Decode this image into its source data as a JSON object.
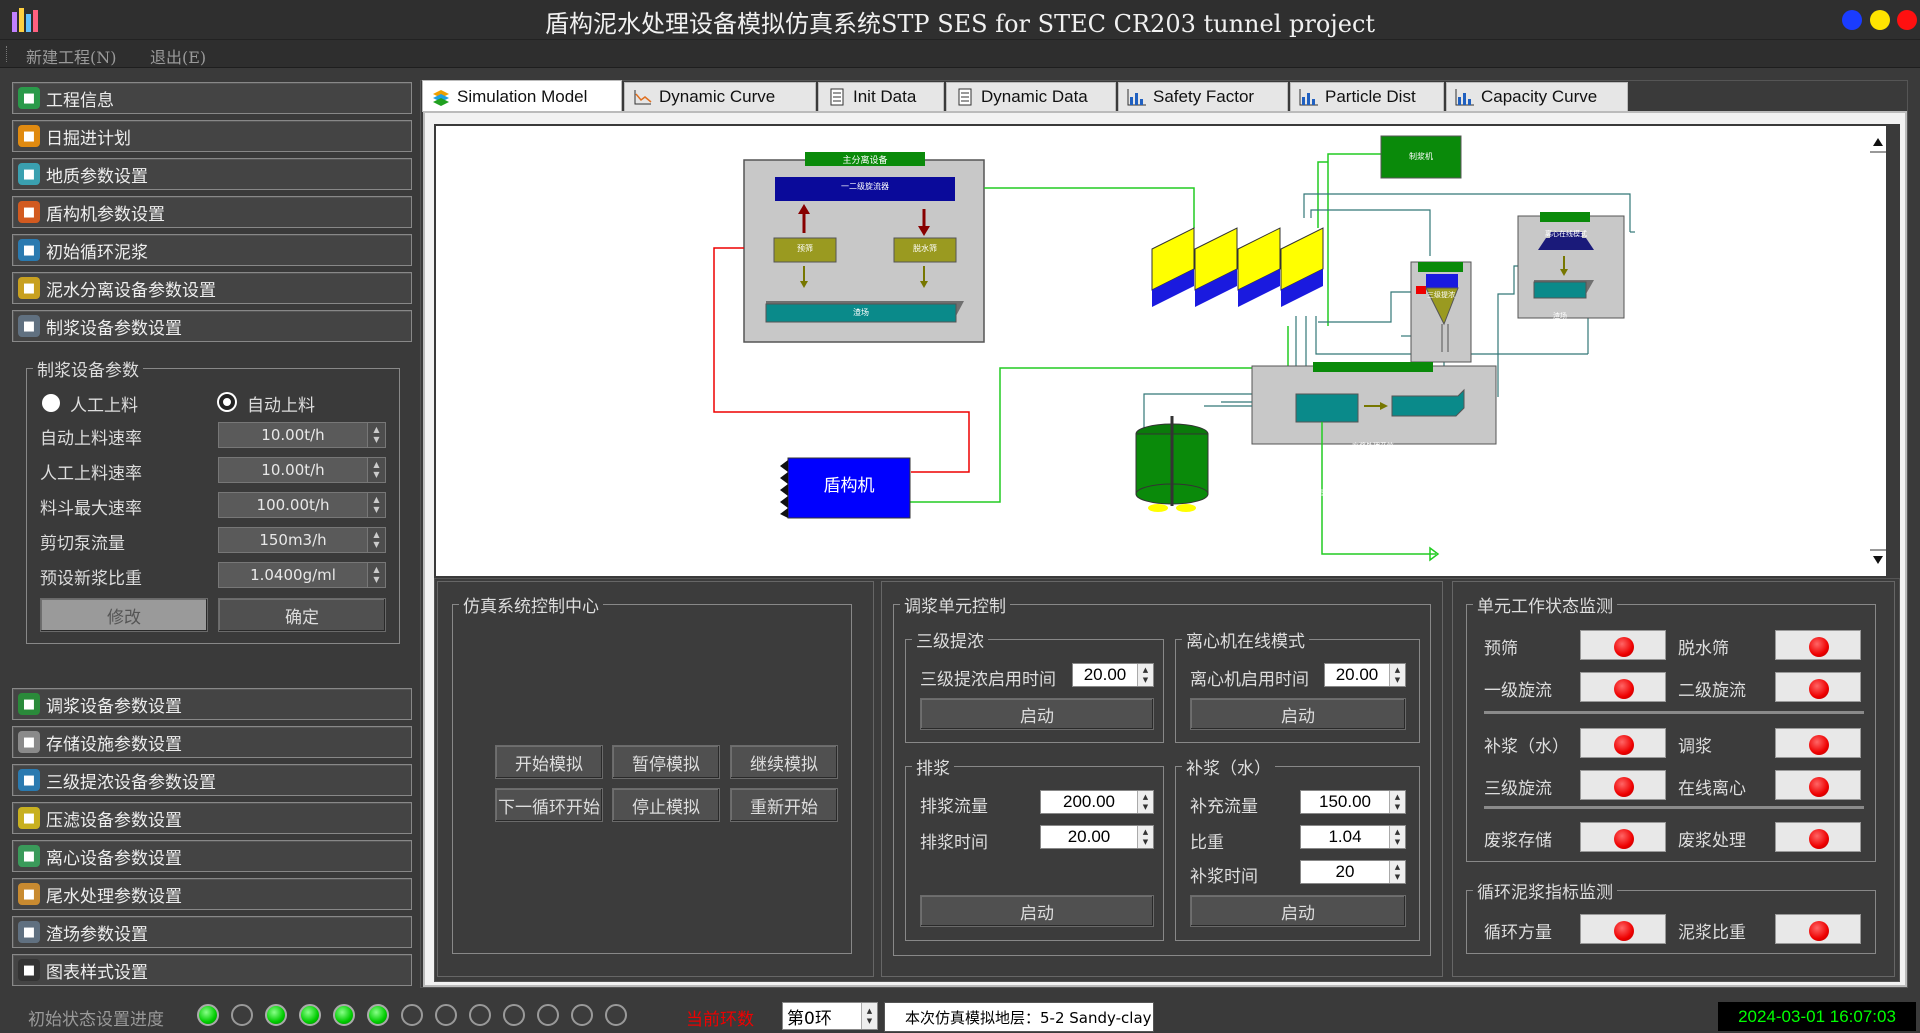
{
  "window": {
    "title": "盾构泥水处理设备模拟仿真系统STP SES for STEC CR203 tunnel project"
  },
  "menu": {
    "new_project": "新建工程(N)",
    "exit": "退出(E)"
  },
  "nav_top": [
    {
      "label": "工程信息",
      "icon": "project-info-icon",
      "color": "#2a9a4a"
    },
    {
      "label": "日掘进计划",
      "icon": "shield-badge-icon",
      "color": "#e08a10"
    },
    {
      "label": "地质参数设置",
      "icon": "layers-icon",
      "color": "#3aa0b0"
    },
    {
      "label": "盾构机参数设置",
      "icon": "gear-icon",
      "color": "#d25a20"
    },
    {
      "label": "初始循环泥浆",
      "icon": "table-icon",
      "color": "#2a7ab0"
    },
    {
      "label": "泥水分离设备参数设置",
      "icon": "stack-icon",
      "color": "#c8a020"
    },
    {
      "label": "制浆设备参数设置",
      "icon": "calculator-icon",
      "color": "#607080"
    }
  ],
  "slurry_panel": {
    "legend": "制浆设备参数",
    "radio_manual": "人工上料",
    "radio_auto": "自动上料",
    "fields": [
      {
        "label": "自动上料速率",
        "value": "10.00t/h"
      },
      {
        "label": "人工上料速率",
        "value": "10.00t/h"
      },
      {
        "label": "料斗最大速率",
        "value": "100.00t/h"
      },
      {
        "label": "剪切泵流量",
        "value": "150m3/h"
      },
      {
        "label": "预设新浆比重",
        "value": "1.0400g/ml"
      }
    ],
    "modify": "修改",
    "confirm": "确定"
  },
  "nav_bottom": [
    {
      "label": "调浆设备参数设置",
      "icon": "grid-icon",
      "color": "#2a8a3a"
    },
    {
      "label": "存储设施参数设置",
      "icon": "storage-icon",
      "color": "#8a8a8a"
    },
    {
      "label": "三级提浓设备参数设置",
      "icon": "funnel-icon",
      "color": "#2a7ab0"
    },
    {
      "label": "压滤设备参数设置",
      "icon": "calculator-icon",
      "color": "#c8b020"
    },
    {
      "label": "离心设备参数设置",
      "icon": "document-icon",
      "color": "#3a9a5a"
    },
    {
      "label": "尾水处理参数设置",
      "icon": "folder-icon",
      "color": "#c88a30"
    },
    {
      "label": "渣场参数设置",
      "icon": "ledger-icon",
      "color": "#607080"
    },
    {
      "label": "图表样式设置",
      "icon": "cube-icon",
      "color": "#333333"
    }
  ],
  "tabs": [
    {
      "label": "Simulation Model",
      "icon": "stack-icon"
    },
    {
      "label": "Dynamic Curve",
      "icon": "line-chart-icon"
    },
    {
      "label": "Init Data",
      "icon": "document-icon"
    },
    {
      "label": "Dynamic Data",
      "icon": "document-icon"
    },
    {
      "label": "Safety Factor",
      "icon": "bar-chart-icon"
    },
    {
      "label": "Particle Dist",
      "icon": "bar-chart-icon"
    },
    {
      "label": "Capacity Curve",
      "icon": "bar-chart-icon"
    }
  ],
  "diagram": {
    "main_sep": "主分离设备",
    "level12": "一二级旋流器",
    "presieve": "预筛",
    "dewater": "脱水筛",
    "tank": "渣场",
    "pulper": "制浆机",
    "tbm": "盾构机",
    "level3": "三级提浓",
    "centrifuge_mode": "离心在线模式",
    "centrifuge_tank": "渣场",
    "waste_system": "废浆处理系统",
    "filter_centrifuge": "压滤或离心",
    "waste_yard": "渣场"
  },
  "sim_ctrl": {
    "legend": "仿真系统控制中心",
    "start": "开始模拟",
    "pause": "暂停模拟",
    "resume": "继续模拟",
    "next": "下一循环开始",
    "stop": "停止模拟",
    "restart": "重新开始"
  },
  "mix_ctrl": {
    "legend": "调浆单元控制",
    "lvl3": {
      "legend": "三级提浓",
      "label": "三级提浓启用时间",
      "value": "20.00",
      "btn": "启动"
    },
    "centrifuge": {
      "legend": "离心机在线模式",
      "label": "离心机启用时间",
      "value": "20.00",
      "btn": "启动"
    },
    "discharge": {
      "legend": "排浆",
      "flow_label": "排浆流量",
      "flow": "200.00",
      "time_label": "排浆时间",
      "time": "20.00",
      "btn": "启动"
    },
    "refill": {
      "legend": "补浆（水）",
      "flow_label": "补充流量",
      "flow": "150.00",
      "density_label": "比重",
      "density": "1.04",
      "time_label": "补浆时间",
      "time": "20",
      "btn": "启动"
    }
  },
  "monitor": {
    "legend": "单元工作状态监测",
    "items": [
      {
        "label": "预筛"
      },
      {
        "label": "脱水筛"
      },
      {
        "label": "一级旋流"
      },
      {
        "label": "二级旋流"
      },
      {
        "label": "补浆（水）"
      },
      {
        "label": "调浆"
      },
      {
        "label": "三级旋流"
      },
      {
        "label": "在线离心"
      },
      {
        "label": "废浆存储"
      },
      {
        "label": "废浆处理"
      }
    ],
    "cycle_legend": "循环泥浆指标监测",
    "cycle_items": [
      {
        "label": "循环方量"
      },
      {
        "label": "泥浆比重"
      }
    ]
  },
  "status": {
    "progress_label": "初始状态设置进度",
    "leds": [
      1,
      0,
      1,
      1,
      1,
      1,
      0,
      0,
      0,
      0,
      0,
      0,
      0
    ],
    "current_ring_label": "当前环数",
    "ring_value": "第0环",
    "stratum": "本次仿真模拟地层：5-2 Sandy-clay",
    "datetime": "2024-03-01 16:07:03"
  },
  "colors": {
    "accent_green": "#00aa00",
    "alarm_red": "#ee0000",
    "tbm_blue": "#0000ff"
  }
}
